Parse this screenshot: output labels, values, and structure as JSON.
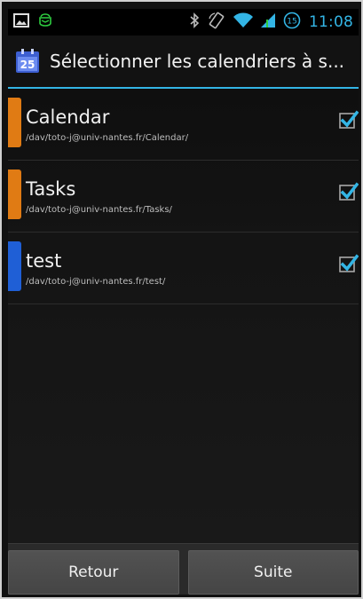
{
  "status_bar": {
    "icons_left": [
      "picture-icon",
      "android-icon"
    ],
    "icons_right": [
      "bluetooth-icon",
      "rotation-lock-icon",
      "wifi-icon",
      "signal-icon",
      "battery-icon"
    ],
    "battery_level_badge": "15",
    "time": "11:08",
    "accent_color": "#33b5e5"
  },
  "action_bar": {
    "app_icon": "calendar-icon",
    "app_icon_day": "25",
    "title": "Sélectionner les calendriers à s..."
  },
  "calendars": [
    {
      "name": "Calendar",
      "path": "/dav/toto-j@univ-nantes.fr/Calendar/",
      "color": "#e07b14",
      "checked": true
    },
    {
      "name": "Tasks",
      "path": "/dav/toto-j@univ-nantes.fr/Tasks/",
      "color": "#e07b14",
      "checked": true
    },
    {
      "name": "test",
      "path": "/dav/toto-j@univ-nantes.fr/test/",
      "color": "#1f5fd6",
      "checked": true
    }
  ],
  "buttons": {
    "back_label": "Retour",
    "next_label": "Suite"
  }
}
